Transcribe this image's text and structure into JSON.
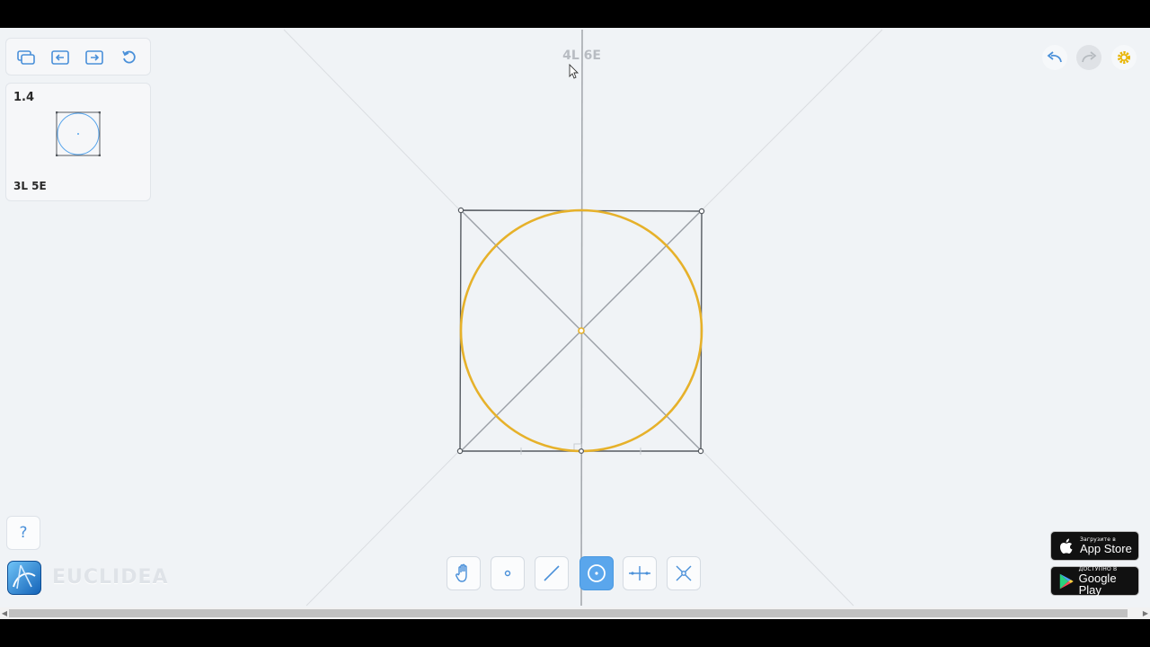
{
  "toolbar_top": {
    "icons": [
      "layers-icon",
      "previous-level-icon",
      "next-level-icon",
      "restart-icon"
    ]
  },
  "level_card": {
    "number": "1.4",
    "stats": "3L 5E"
  },
  "counter": "4L 6E",
  "top_right": {
    "icons": [
      "undo-icon",
      "redo-icon",
      "settings-icon"
    ]
  },
  "tools": [
    {
      "name": "move-tool",
      "icon": "hand-icon",
      "active": false
    },
    {
      "name": "point-tool",
      "icon": "point-icon",
      "active": false
    },
    {
      "name": "line-tool",
      "icon": "line-icon",
      "active": false
    },
    {
      "name": "circle-tool",
      "icon": "circle-icon",
      "active": true
    },
    {
      "name": "perpendicular-bisector-tool",
      "icon": "perpendicular-bisector-icon",
      "active": false
    },
    {
      "name": "intersect-tool",
      "icon": "intersect-icon",
      "active": false
    }
  ],
  "help": {
    "label": "?"
  },
  "brand": {
    "name": "EUCLIDEA"
  },
  "stores": {
    "appstore": {
      "small": "Загрузите в",
      "big": "App Store"
    },
    "googleplay": {
      "small": "ДОСТУПНО В",
      "big": "Google Play"
    }
  },
  "colors": {
    "accent": "#5aa6ec",
    "circle": "#e6b12a",
    "construction": "#9a9fa6",
    "square": "#555a60"
  }
}
